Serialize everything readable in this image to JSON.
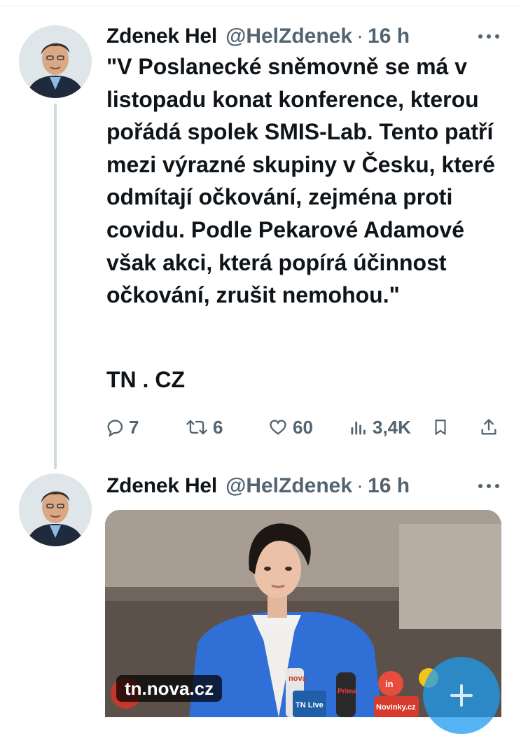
{
  "tweet1": {
    "author_name": "Zdenek Hel",
    "author_handle": "@HelZdenek",
    "separator": "·",
    "time": "16 h",
    "text": "\"V Poslanecké sněmovně se má v listopadu konat konference, kterou pořádá spolek SMIS-Lab. Tento patří mezi výrazné skupiny v Česku, které odmítají očkování, zejména proti covidu. Podle Pekarové Adamové však akci, která popírá účinnost očkování, zrušit nemohou.\"",
    "source": "TN . CZ",
    "replies": "7",
    "retweets": "6",
    "likes": "60",
    "views": "3,4K",
    "icons": [
      "more-icon",
      "reply-icon",
      "retweet-icon",
      "like-icon",
      "views-icon",
      "bookmark-icon",
      "share-icon"
    ]
  },
  "tweet2": {
    "author_name": "Zdenek Hel",
    "author_handle": "@HelZdenek",
    "separator": "·",
    "time": "16 h",
    "media_source_label": "tn.nova.cz",
    "media_mic_labels": [
      "nova",
      "TN Live",
      "Prima",
      "in",
      "Novinky.cz"
    ],
    "icons": [
      "more-icon",
      "compose-icon"
    ]
  },
  "colors": {
    "text": "#0f1419",
    "secondary": "#536471",
    "thread_line": "#cfd9de",
    "accent": "#1d9bf0",
    "jacket_blue": "#2f6fd6"
  }
}
